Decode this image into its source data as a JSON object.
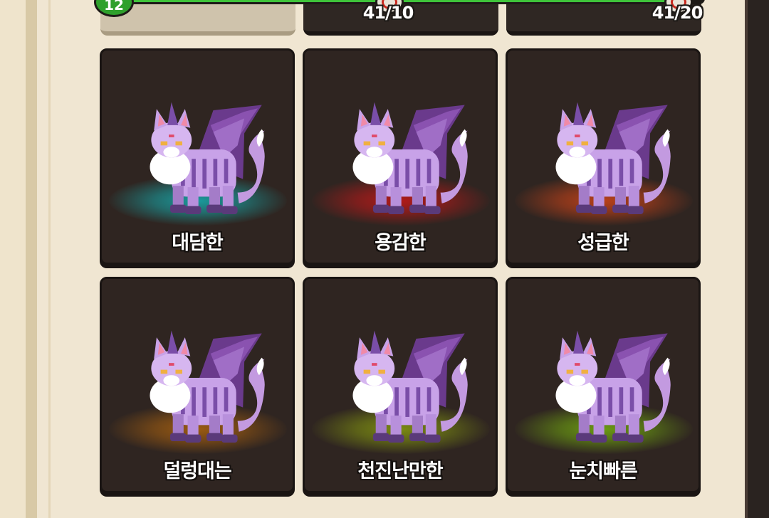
{
  "progress": {
    "level": "12",
    "fill_fraction": 0.95,
    "milestones": [
      "41/10",
      "41/20"
    ],
    "fill_color": "#3fc43a"
  },
  "pets": [
    {
      "name": "대담한",
      "aura_color": "#1a9a9c"
    },
    {
      "name": "용감한",
      "aura_color": "#b01a1a"
    },
    {
      "name": "성급한",
      "aura_color": "#b8401a"
    },
    {
      "name": "덜렁대는",
      "aura_color": "#9a5a12"
    },
    {
      "name": "천진난만한",
      "aura_color": "#7a8a12"
    },
    {
      "name": "눈치빠른",
      "aura_color": "#6a9a12"
    }
  ],
  "sprite": {
    "icon": "purple-winged-cat-icon"
  }
}
